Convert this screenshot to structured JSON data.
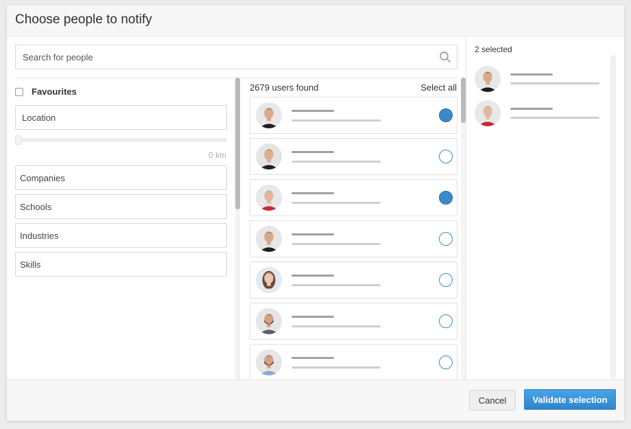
{
  "dialog": {
    "title": "Choose people to notify"
  },
  "search": {
    "placeholder": "Search for people"
  },
  "filters": {
    "favourites_label": "Favourites",
    "location_label": "Location",
    "distance_label": "0 km",
    "distance_value": 0,
    "fields": [
      "Companies",
      "Schools",
      "Industries",
      "Skills"
    ]
  },
  "results": {
    "count_label": "2679 users found",
    "select_all_label": "Select all",
    "users": [
      {
        "avatar": "man-dark-hair-black-shirt",
        "selected": true
      },
      {
        "avatar": "man-brown-hair-black-shirt",
        "selected": false
      },
      {
        "avatar": "woman-grey-hair-red-sweater",
        "selected": true
      },
      {
        "avatar": "man-short-hair-black-shirt",
        "selected": false
      },
      {
        "avatar": "woman-long-brown-hair",
        "selected": false
      },
      {
        "avatar": "man-beard-grey-shirt",
        "selected": false
      },
      {
        "avatar": "man-beard-blue-shirt",
        "selected": false
      }
    ]
  },
  "selected": {
    "count_label": "2 selected",
    "items": [
      {
        "avatar": "man-dark-hair-black-shirt"
      },
      {
        "avatar": "woman-grey-hair-red-sweater"
      }
    ]
  },
  "footer": {
    "cancel_label": "Cancel",
    "validate_label": "Validate selection"
  },
  "colors": {
    "accent": "#3a8ac8",
    "validate_button": "#2d86cc"
  }
}
